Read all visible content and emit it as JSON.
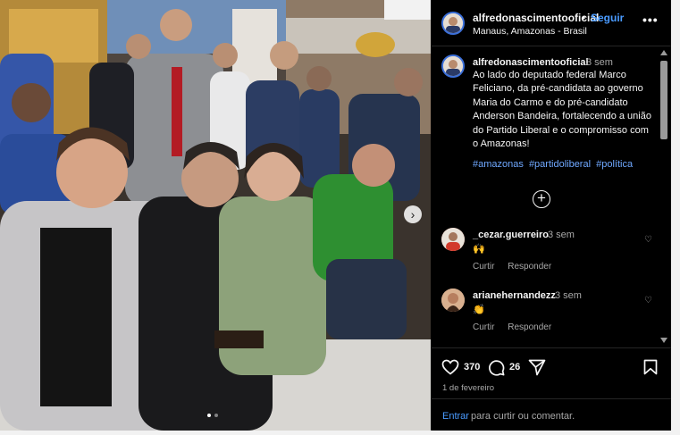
{
  "header": {
    "username": "alfredonascimentooficial",
    "separator": "•",
    "follow_label": "Seguir",
    "location": "Manaus, Amazonas - Brasil",
    "more_icon": "more-options-icon"
  },
  "caption": {
    "username": "alfredonascimentooficial",
    "time": "3 sem",
    "text": "Ao lado do deputado federal Marco Feliciano, da pré-candidata ao governo Maria do Carmo e do pré-candidato Anderson Bandeira, fortalecendo a união do Partido Liberal e o compromisso com o Amazonas!",
    "hashtags": [
      "#amazonas",
      "#partidoliberal",
      "#política"
    ]
  },
  "comments": [
    {
      "username": "_cezar.guerreiro",
      "time": "3 sem",
      "text": "🙌",
      "like_label": "Curtir",
      "reply_label": "Responder"
    },
    {
      "username": "arianehernandezz",
      "time": "3 sem",
      "text": "👏",
      "like_label": "Curtir",
      "reply_label": "Responder"
    }
  ],
  "actions": {
    "likes": "370",
    "comments": "26",
    "date": "1 de fevereiro"
  },
  "login": {
    "link": "Entrar",
    "text": "para curtir ou comentar."
  },
  "colors": {
    "background": "#000000",
    "link": "#4a9bff",
    "hashtag": "#6fa8ff",
    "muted": "#a8a8a8"
  },
  "carousel": {
    "current": 1,
    "total": 2
  }
}
